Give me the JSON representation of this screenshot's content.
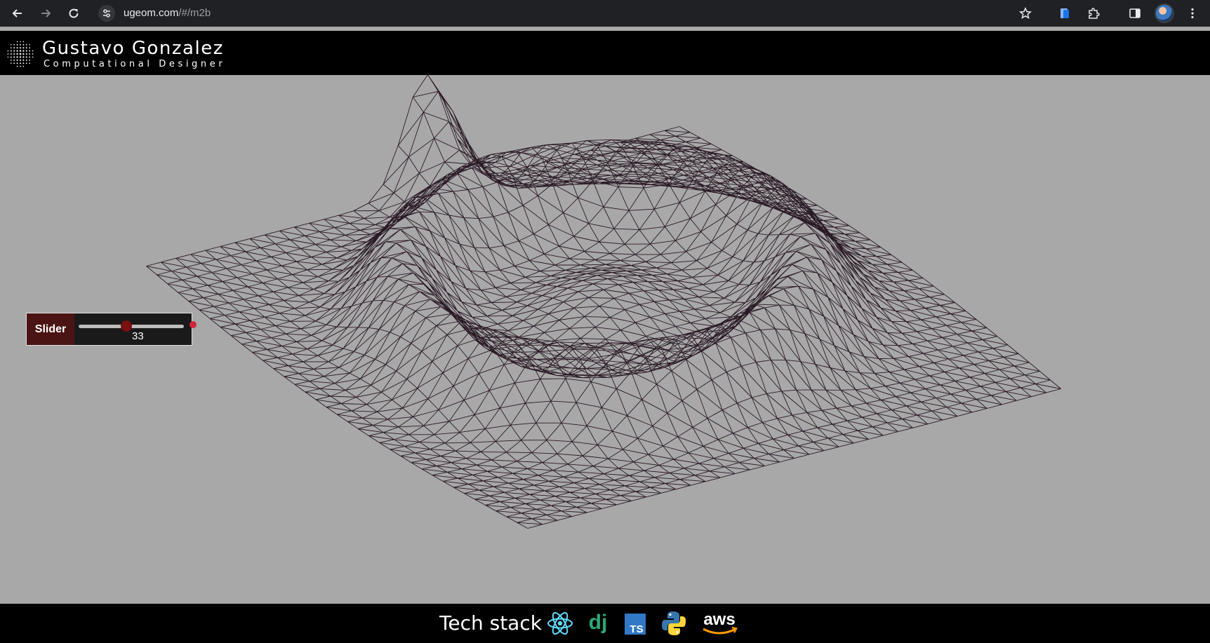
{
  "browser": {
    "url_host": "ugeom.com",
    "url_path": "/#/m2b"
  },
  "site": {
    "name": "Gustavo Gonzalez",
    "title": "Computational Designer"
  },
  "slider": {
    "label": "Slider",
    "value": "33",
    "fraction": 0.45
  },
  "footer": {
    "label": "Tech stack",
    "icons": [
      "react-icon",
      "django-icon",
      "typescript-icon",
      "python-icon",
      "aws-icon"
    ],
    "django_text": "dj",
    "ts_text": "TS",
    "aws_text": "aws"
  },
  "colors": {
    "viewport_bg": "#a8a8a8",
    "mesh_stroke": "#2a1a26",
    "slider_accent": "#7a1010"
  }
}
